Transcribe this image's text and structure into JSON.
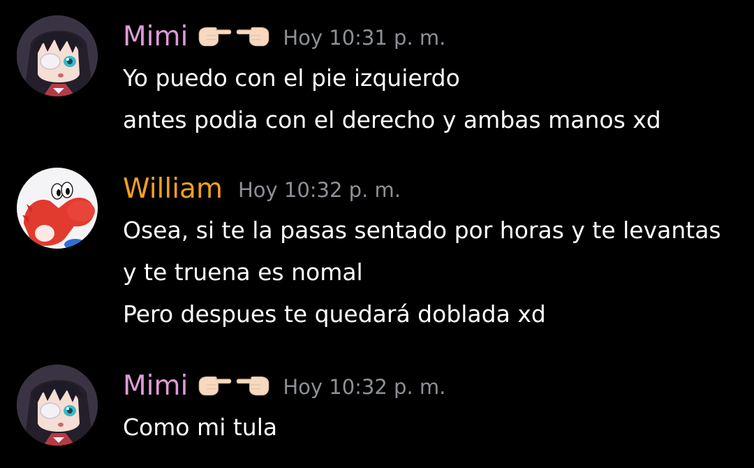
{
  "colors": {
    "background": "#000000",
    "mimi_name": "#dd9bd8",
    "william_name": "#f2a020",
    "timestamp": "#8d9096",
    "text": "#ffffff"
  },
  "messages": [
    {
      "username": "Mimi",
      "avatar": "anime-girl-eyepatch-avatar",
      "name_icons": [
        "pointing-right-hand-icon",
        "pointing-left-hand-icon"
      ],
      "timestamp": "Hoy 10:31 p. m.",
      "lines": [
        "Yo puedo con el pie izquierdo",
        "antes podia con el derecho y ambas manos xd"
      ]
    },
    {
      "username": "William",
      "avatar": "red-yoshi-avatar",
      "timestamp": "Hoy 10:32 p. m.",
      "lines": [
        "Osea, si te la pasas sentado por horas y te levantas",
        "y te truena es nomal",
        "Pero despues te quedará doblada xd"
      ]
    },
    {
      "username": "Mimi",
      "avatar": "anime-girl-eyepatch-avatar",
      "name_icons": [
        "pointing-right-hand-icon",
        "pointing-left-hand-icon"
      ],
      "timestamp": "Hoy 10:32 p. m.",
      "lines": [
        "Como mi tula"
      ]
    }
  ]
}
